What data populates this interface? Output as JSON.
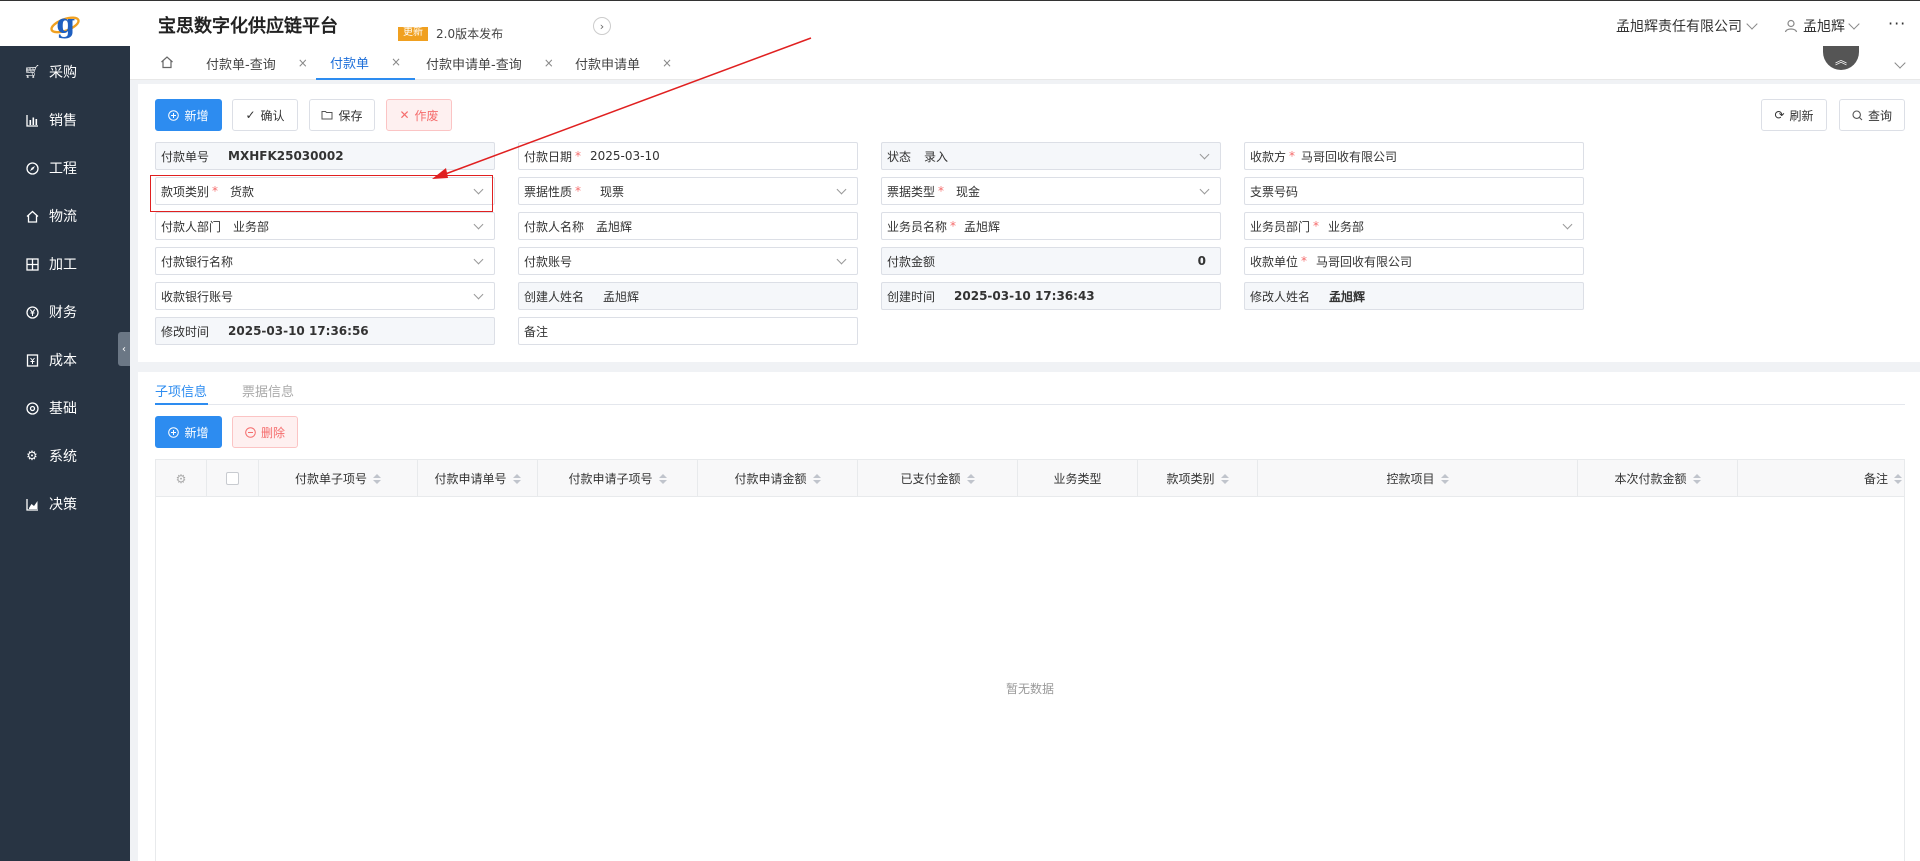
{
  "header": {
    "title": "宝思数字化供应链平台",
    "notice_badge": "更新",
    "notice_text": "2.0版本发布",
    "company": "孟旭辉责任有限公司",
    "user": "孟旭辉",
    "more": "···"
  },
  "sidebar": {
    "items": [
      {
        "label": "采购",
        "icon": "cart-icon"
      },
      {
        "label": "销售",
        "icon": "bar-chart-icon"
      },
      {
        "label": "工程",
        "icon": "compass-icon"
      },
      {
        "label": "物流",
        "icon": "house-icon"
      },
      {
        "label": "加工",
        "icon": "grid-icon"
      },
      {
        "label": "财务",
        "icon": "yen-icon"
      },
      {
        "label": "成本",
        "icon": "ledger-icon"
      },
      {
        "label": "基础",
        "icon": "settings-circle-icon"
      },
      {
        "label": "系统",
        "icon": "gear-icon"
      },
      {
        "label": "决策",
        "icon": "line-chart-icon"
      }
    ]
  },
  "tabs": [
    {
      "label": "付款单-查询",
      "active": false
    },
    {
      "label": "付款单",
      "active": true
    },
    {
      "label": "付款申请单-查询",
      "active": false
    },
    {
      "label": "付款申请单",
      "active": false
    }
  ],
  "toolbar": {
    "add": "新增",
    "confirm": "确认",
    "save": "保存",
    "void": "作废",
    "refresh": "刷新",
    "query": "查询"
  },
  "form": {
    "pay_no": {
      "label": "付款单号",
      "value": "MXHFK25030002"
    },
    "pay_date": {
      "label": "付款日期",
      "value": "2025-03-10"
    },
    "status": {
      "label": "状态",
      "value": "录入"
    },
    "payee": {
      "label": "收款方",
      "value": "马哥回收有限公司"
    },
    "item_type": {
      "label": "款项类别",
      "value": "货款"
    },
    "bill_nature": {
      "label": "票据性质",
      "value": "现票"
    },
    "bill_type": {
      "label": "票据类型",
      "value": "现金"
    },
    "check_no": {
      "label": "支票号码",
      "value": ""
    },
    "payer_dept": {
      "label": "付款人部门",
      "value": "业务部"
    },
    "payer_name": {
      "label": "付款人名称",
      "value": "孟旭辉"
    },
    "sales_name": {
      "label": "业务员名称",
      "value": "孟旭辉"
    },
    "sales_dept": {
      "label": "业务员部门",
      "value": "业务部"
    },
    "pay_bank": {
      "label": "付款银行名称",
      "value": ""
    },
    "pay_account": {
      "label": "付款账号",
      "value": ""
    },
    "pay_amount": {
      "label": "付款金额",
      "value": "0"
    },
    "receiver_unit": {
      "label": "收款单位",
      "value": "马哥回收有限公司"
    },
    "recv_bank_account": {
      "label": "收款银行账号",
      "value": ""
    },
    "creator": {
      "label": "创建人姓名",
      "value": "孟旭辉"
    },
    "created_at": {
      "label": "创建时间",
      "value": "2025-03-10 17:36:43"
    },
    "modifier": {
      "label": "修改人姓名",
      "value": "孟旭辉"
    },
    "modified_at": {
      "label": "修改时间",
      "value": "2025-03-10 17:36:56"
    },
    "remark": {
      "label": "备注",
      "value": ""
    }
  },
  "detail": {
    "tabs": [
      "子项信息",
      "票据信息"
    ],
    "add": "新增",
    "delete": "删除",
    "columns": [
      "付款单子项号",
      "付款申请单号",
      "付款申请子项号",
      "付款申请金额",
      "已支付金额",
      "业务类型",
      "款项类别",
      "控款项目",
      "本次付款金额",
      "备注"
    ],
    "empty": "暂无数据"
  },
  "colors": {
    "sidebar_bg": "#283443",
    "primary": "#2d8cf0",
    "danger": "#f56c6c",
    "annotation": "#e02020"
  }
}
